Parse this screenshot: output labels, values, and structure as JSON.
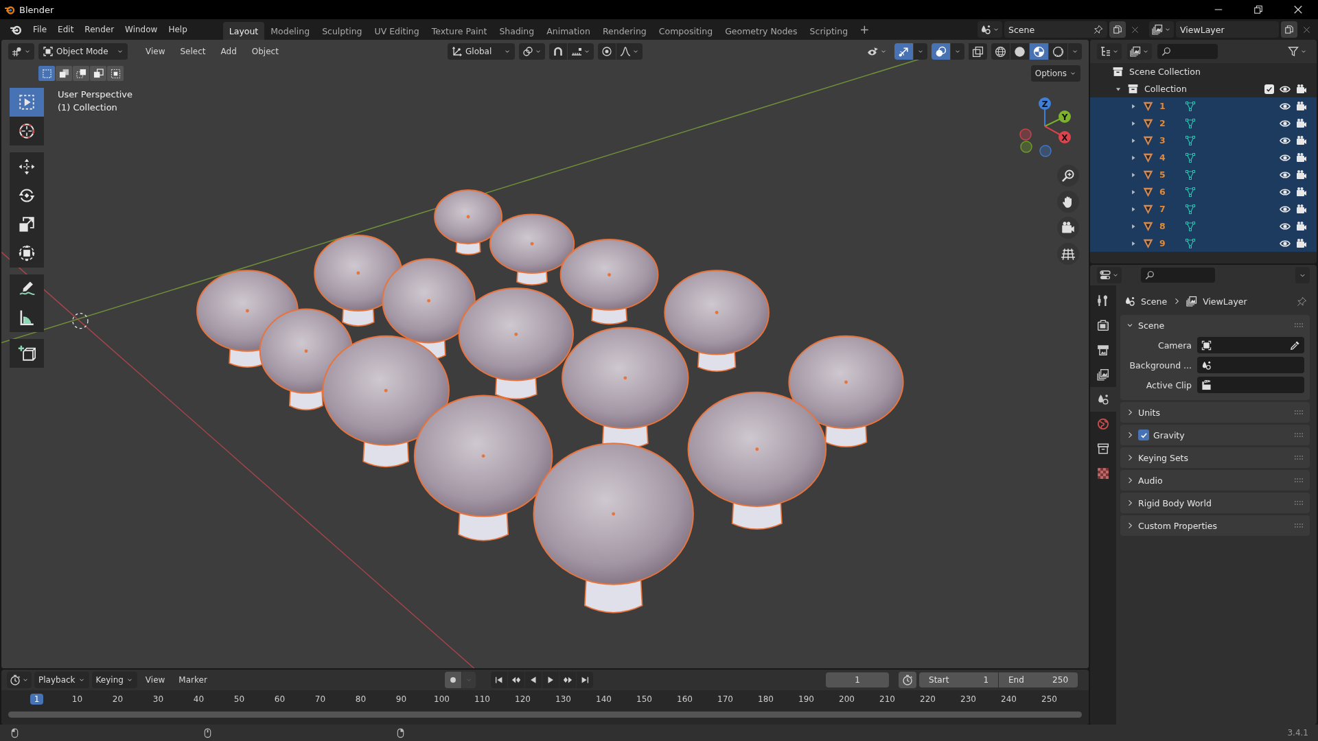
{
  "window": {
    "title": "Blender"
  },
  "menu": [
    "File",
    "Edit",
    "Render",
    "Window",
    "Help"
  ],
  "workspaces": [
    {
      "label": "Layout",
      "selected": true
    },
    {
      "label": "Modeling",
      "selected": false
    },
    {
      "label": "Sculpting",
      "selected": false
    },
    {
      "label": "UV Editing",
      "selected": false
    },
    {
      "label": "Texture Paint",
      "selected": false
    },
    {
      "label": "Shading",
      "selected": false
    },
    {
      "label": "Animation",
      "selected": false
    },
    {
      "label": "Rendering",
      "selected": false
    },
    {
      "label": "Compositing",
      "selected": false
    },
    {
      "label": "Geometry Nodes",
      "selected": false
    },
    {
      "label": "Scripting",
      "selected": false
    }
  ],
  "add_workspace": "+",
  "scene": {
    "name": "Scene"
  },
  "view_layer": {
    "name": "ViewLayer"
  },
  "viewport": {
    "mode": "Object Mode",
    "menus": [
      "View",
      "Select",
      "Add",
      "Object"
    ],
    "orientation": "Global",
    "options": "Options",
    "toggles": [
      {
        "kind": "gizmo",
        "on": true
      },
      {
        "kind": "overlay",
        "on": true
      },
      {
        "kind": "xray",
        "on": false
      }
    ],
    "shading": [
      {
        "kind": "wireframe",
        "selected": false
      },
      {
        "kind": "solid",
        "selected": false
      },
      {
        "kind": "material",
        "selected": true
      },
      {
        "kind": "rendered",
        "selected": false
      }
    ],
    "select_modes": [
      {
        "kind": "new",
        "selected": true
      },
      {
        "kind": "extend",
        "selected": false
      },
      {
        "kind": "subtract",
        "selected": false
      },
      {
        "kind": "invert",
        "selected": false
      },
      {
        "kind": "intersect",
        "selected": false
      }
    ],
    "overlay_text": [
      "User Perspective",
      "(1) Collection"
    ],
    "tools": [
      {
        "kind": "select",
        "selected": true
      },
      {
        "kind": "cursor",
        "selected": false
      },
      {
        "kind": "move",
        "selected": false
      },
      {
        "kind": "rotate",
        "selected": false
      },
      {
        "kind": "scale",
        "selected": false
      },
      {
        "kind": "transform",
        "selected": false
      },
      {
        "kind": "annotate",
        "selected": false
      },
      {
        "kind": "measure",
        "selected": false
      },
      {
        "kind": "add_cube",
        "selected": false
      }
    ],
    "gizmo_axes": [
      "Z",
      "Y",
      "X"
    ]
  },
  "timeline": {
    "menus": [
      "Playback",
      "Keying",
      "View",
      "Marker"
    ],
    "current_frame": "1",
    "start_label": "Start",
    "start": "1",
    "end_label": "End",
    "end": "250",
    "ruler": {
      "current": "1",
      "ticks": [
        "10",
        "20",
        "30",
        "40",
        "50",
        "60",
        "70",
        "80",
        "90",
        "100",
        "110",
        "120",
        "130",
        "140",
        "150",
        "160",
        "170",
        "180",
        "190",
        "200",
        "210",
        "220",
        "230",
        "240",
        "250"
      ]
    }
  },
  "outliner": {
    "tree": [
      {
        "label": "Scene Collection",
        "kind": "scene_collection",
        "selected": false,
        "children": [
          {
            "label": "Collection",
            "kind": "collection",
            "expanded": true,
            "checked": true,
            "selected": false,
            "children": [
              {
                "label": "1",
                "kind": "object",
                "expanded": false,
                "selected": true
              },
              {
                "label": "2",
                "kind": "object",
                "expanded": false,
                "selected": true
              },
              {
                "label": "3",
                "kind": "object",
                "expanded": false,
                "selected": true
              },
              {
                "label": "4",
                "kind": "object",
                "expanded": false,
                "selected": true
              },
              {
                "label": "5",
                "kind": "object",
                "expanded": false,
                "selected": true
              },
              {
                "label": "6",
                "kind": "object",
                "expanded": false,
                "selected": true
              },
              {
                "label": "7",
                "kind": "object",
                "expanded": false,
                "selected": true
              },
              {
                "label": "8",
                "kind": "object",
                "expanded": false,
                "selected": true
              },
              {
                "label": "9",
                "kind": "object",
                "expanded": false,
                "selected": true
              }
            ]
          }
        ]
      }
    ]
  },
  "properties": {
    "tabs": [
      {
        "kind": "tool",
        "selected": false
      },
      {
        "kind": "render",
        "selected": false
      },
      {
        "kind": "output",
        "selected": false
      },
      {
        "kind": "view_layer",
        "selected": false
      },
      {
        "kind": "scene",
        "selected": true
      },
      {
        "kind": "world",
        "selected": false
      },
      {
        "kind": "collection",
        "selected": false
      },
      {
        "kind": "texture",
        "selected": false
      }
    ],
    "breadcrumb": [
      "Scene",
      "ViewLayer"
    ],
    "panels": [
      {
        "title": "Scene",
        "expanded": true,
        "fields": [
          {
            "label": "Camera",
            "kind": "camera"
          },
          {
            "label": "Background ...",
            "kind": "scene"
          },
          {
            "label": "Active Clip",
            "kind": "clip"
          }
        ]
      },
      {
        "title": "Units",
        "expanded": false
      },
      {
        "title": "Gravity",
        "expanded": false,
        "checked": true
      },
      {
        "title": "Keying Sets",
        "expanded": false
      },
      {
        "title": "Audio",
        "expanded": false
      },
      {
        "title": "Rigid Body World",
        "expanded": false
      },
      {
        "title": "Custom Properties",
        "expanded": false
      }
    ]
  },
  "status_bar": {
    "version": "3.4.1"
  }
}
